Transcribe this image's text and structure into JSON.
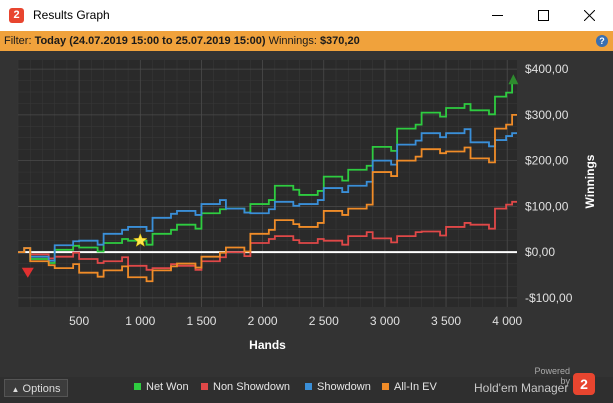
{
  "window": {
    "title": "Results Graph",
    "app_icon_glyph": "2",
    "controls": [
      "minimize-icon",
      "maximize-icon",
      "close-icon"
    ]
  },
  "filter": {
    "label": "Filter:",
    "value": "Today (24.07.2019 15:00 to 25.07.2019 15:00)",
    "winnings_label": "Winnings:",
    "winnings_value": "$370,20",
    "help_icon": "help-icon"
  },
  "colors": {
    "net_won": "#2ecc40",
    "non_showdown": "#e04848",
    "showdown": "#3a8fd8",
    "all_in_ev": "#f08c28",
    "filter_bar": "#f0a23c",
    "zero_line": "#ffffff"
  },
  "chart_data": {
    "type": "line",
    "xlabel": "Hands",
    "ylabel": "Winnings",
    "xlim": [
      0,
      4080
    ],
    "ylim": [
      -120,
      420
    ],
    "x_ticks": [
      500,
      1000,
      1500,
      2000,
      2500,
      3000,
      3500,
      4000
    ],
    "x_tick_labels": [
      "500",
      "1 000",
      "1 500",
      "2 000",
      "2 500",
      "3 000",
      "3 500",
      "4 000"
    ],
    "y_ticks": [
      -100,
      0,
      100,
      200,
      300,
      400
    ],
    "y_tick_labels": [
      "-$100,00",
      "$0,00",
      "$100,00",
      "$200,00",
      "$300,00",
      "$400,00"
    ],
    "grid": true,
    "zero_line": true,
    "x": [
      0,
      200,
      400,
      600,
      800,
      1000,
      1200,
      1400,
      1600,
      1800,
      2000,
      2200,
      2400,
      2600,
      2800,
      3000,
      3200,
      3400,
      3600,
      3800,
      4000,
      4080
    ],
    "series": [
      {
        "name": "Net Won",
        "color_key": "net_won",
        "values": [
          0,
          -15,
          5,
          10,
          20,
          25,
          40,
          60,
          85,
          95,
          105,
          145,
          125,
          165,
          180,
          230,
          270,
          305,
          315,
          310,
          340,
          370
        ]
      },
      {
        "name": "Non Showdown",
        "color_key": "non_showdown",
        "values": [
          0,
          -5,
          -10,
          -15,
          -20,
          -30,
          -35,
          -30,
          -20,
          0,
          20,
          35,
          20,
          25,
          35,
          30,
          35,
          45,
          55,
          60,
          95,
          110
        ]
      },
      {
        "name": "Showdown",
        "color_key": "showdown",
        "values": [
          0,
          -10,
          15,
          25,
          40,
          55,
          75,
          90,
          105,
          95,
          85,
          110,
          105,
          140,
          145,
          200,
          235,
          260,
          260,
          240,
          245,
          260
        ]
      },
      {
        "name": "All-In EV",
        "color_key": "all_in_ev",
        "values": [
          0,
          -20,
          -35,
          -45,
          -40,
          -55,
          -40,
          -25,
          -10,
          10,
          40,
          70,
          55,
          90,
          95,
          175,
          200,
          225,
          220,
          205,
          270,
          300
        ]
      }
    ],
    "markers": [
      {
        "type": "min",
        "x": 80,
        "y": -45,
        "color": "#e03030",
        "shape": "triangle-down"
      },
      {
        "type": "star",
        "x": 1000,
        "y": 25,
        "color": "#ffe84a",
        "shape": "star"
      },
      {
        "type": "max",
        "x": 4050,
        "y": 378,
        "color": "#2e8b2e",
        "shape": "triangle-up"
      }
    ]
  },
  "bottom": {
    "options_label": "Options",
    "legend": [
      "Net Won",
      "Non Showdown",
      "Showdown",
      "All-In EV"
    ],
    "powered_by": "Powered by",
    "brand": "Hold'em Manager",
    "brand_logo_glyph": "2"
  }
}
